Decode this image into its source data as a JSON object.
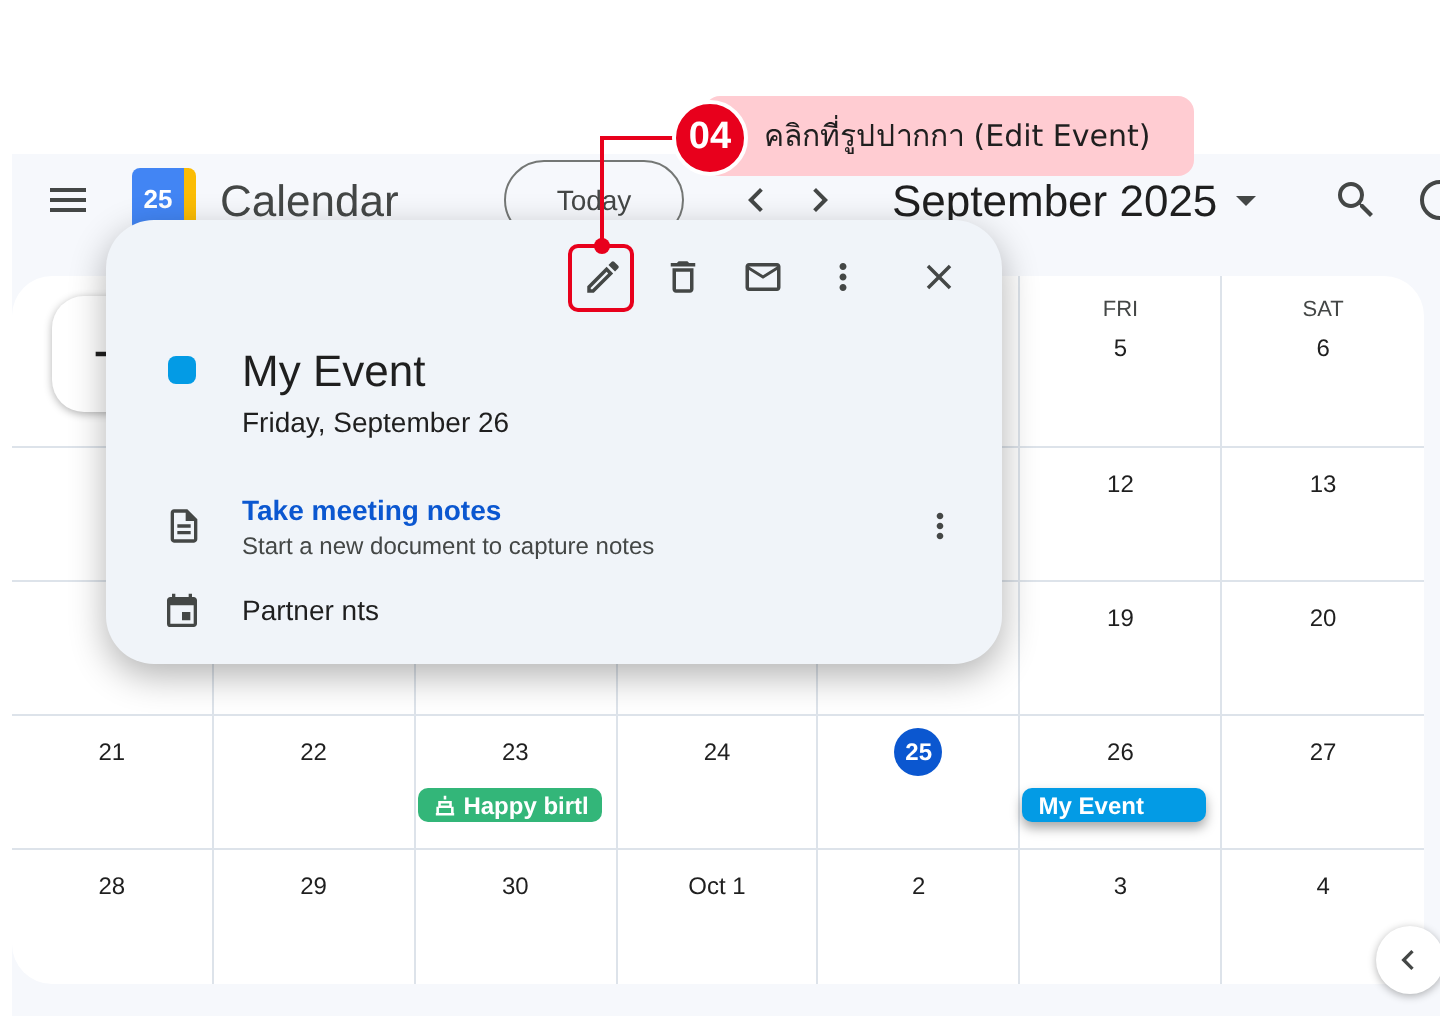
{
  "header": {
    "logo_text": "25",
    "title": "Calendar",
    "today_button": "Today",
    "month_label": "September 2025"
  },
  "grid": {
    "weeks": [
      {
        "days": [
          {
            "weekday": "FRI",
            "date": "5",
            "today": false
          },
          {
            "weekday": "SAT",
            "date": "6",
            "today": false
          }
        ]
      },
      {
        "days": [
          {
            "date": "12",
            "today": false
          },
          {
            "date": "13",
            "today": false
          }
        ]
      },
      {
        "days": [
          {
            "date": "19",
            "today": false
          },
          {
            "date": "20",
            "today": false
          }
        ]
      },
      {
        "days": [
          {
            "date": "21",
            "today": false
          },
          {
            "date": "22",
            "today": false
          },
          {
            "date": "23",
            "today": false,
            "events": [
              {
                "kind": "birthday",
                "title": "Happy birtl",
                "color": "#33b679",
                "selected": false
              }
            ]
          },
          {
            "date": "24",
            "today": false
          },
          {
            "date": "25",
            "today": true
          },
          {
            "date": "26",
            "today": false,
            "events": [
              {
                "kind": "event",
                "title": "My Event",
                "color": "#039be5",
                "selected": true
              }
            ]
          },
          {
            "date": "27",
            "today": false
          }
        ]
      },
      {
        "days": [
          {
            "date": "28",
            "today": false
          },
          {
            "date": "29",
            "today": false
          },
          {
            "date": "30",
            "today": false
          },
          {
            "date": "Oct 1",
            "today": false
          },
          {
            "date": "2",
            "today": false
          },
          {
            "date": "3",
            "today": false
          },
          {
            "date": "4",
            "today": false
          }
        ]
      }
    ]
  },
  "event_popup": {
    "toolbar": [
      {
        "kind": "edit",
        "highlighted": true
      },
      {
        "kind": "delete",
        "highlighted": false
      },
      {
        "kind": "email",
        "highlighted": false
      },
      {
        "kind": "more",
        "highlighted": false
      },
      {
        "kind": "close",
        "highlighted": false
      }
    ],
    "color": "#039be5",
    "title": "My Event",
    "date": "Friday, September 26",
    "notes_link": "Take meeting notes",
    "notes_hint": "Start a new document to capture notes",
    "calendar_name": "Partner nts"
  },
  "annotation": {
    "step": "04",
    "text": "คลิกที่รูปปากกา (Edit Event)"
  }
}
